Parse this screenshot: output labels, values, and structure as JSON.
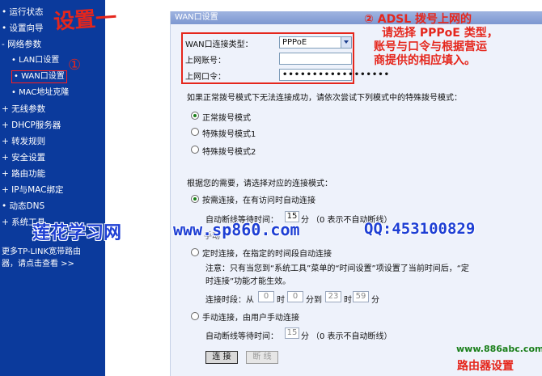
{
  "sidebar": {
    "items": [
      {
        "label": "• 运行状态"
      },
      {
        "label": "• 设置向导"
      },
      {
        "label": "- 网络参数"
      },
      {
        "label": "• LAN口设置"
      },
      {
        "label": "• WAN口设置"
      },
      {
        "label": "• MAC地址克隆"
      },
      {
        "label": "+ 无线参数"
      },
      {
        "label": "+ DHCP服务器"
      },
      {
        "label": "+ 转发规则"
      },
      {
        "label": "+ 安全设置"
      },
      {
        "label": "+ 路由功能"
      },
      {
        "label": "+ IP与MAC绑定"
      },
      {
        "label": "• 动态DNS"
      },
      {
        "label": "+ 系统工具"
      }
    ],
    "note_line1": "更多TP-LINK宽带路由",
    "note_line2": "器，请点击查看 >>"
  },
  "panel": {
    "title": "WAN口设置",
    "wan_type_label": "WAN口连接类型：",
    "wan_type_value": "PPPoE",
    "account_label": "上网账号：",
    "account_value": "",
    "password_label": "上网口令：",
    "password_value": "••••••••••••••••••",
    "special_hint": "如果正常拨号模式下无法连接成功，请依次尝试下列模式中的特殊拨号模式：",
    "dial_modes": [
      {
        "label": "正常拨号模式",
        "selected": true
      },
      {
        "label": "特殊拨号模式1",
        "selected": false
      },
      {
        "label": "特殊拨号模式2",
        "selected": false
      }
    ],
    "mode_hint": "根据您的需要，请选择对应的连接模式：",
    "on_demand_label": "按需连接，在有访问时自动连接",
    "idle_label": "自动断线等待时间：",
    "idle_value": "15",
    "idle_unit": "分",
    "idle_note": "（0 表示不自动断线）",
    "manual_partial": "手动",
    "timed_label": "定时连接，在指定的时间段自动连接",
    "note_line1": "注意：只有当您到“系统工具”菜单的“时间设置”项设置了当前时间后，“定",
    "note_line2": "时连接”功能才能生效。",
    "period_label": "连接时段：从",
    "from_h": "0",
    "from_h_unit": "时",
    "from_m": "0",
    "from_m_unit": "分到",
    "to_h": "23",
    "to_h_unit": "时",
    "to_m": "59",
    "to_m_unit": "分",
    "manual_label": "手动连接，由用户手动连接",
    "idle2_label": "自动断线等待时间：",
    "idle2_value": "15",
    "idle2_unit": "分",
    "idle2_note": "（0 表示不自动断线）",
    "connect_button": "连 接",
    "disconnect_button": "断 线"
  },
  "annotations": {
    "step1_title": "设置一",
    "circle1": "①",
    "step2_line1": "② ADSL 拨号上网的",
    "step2_line2": "请选择 PPPoE 类型，",
    "step2_line3": "账号与口令与根据营运",
    "step2_line4": "商提供的相应填入。",
    "watermark_left": "莲花学习网",
    "watermark_mid": "www.sp860.com",
    "watermark_right": "QQ:453100829",
    "footer_url": "www.886abc.com",
    "footer_title": "路由器设置"
  }
}
